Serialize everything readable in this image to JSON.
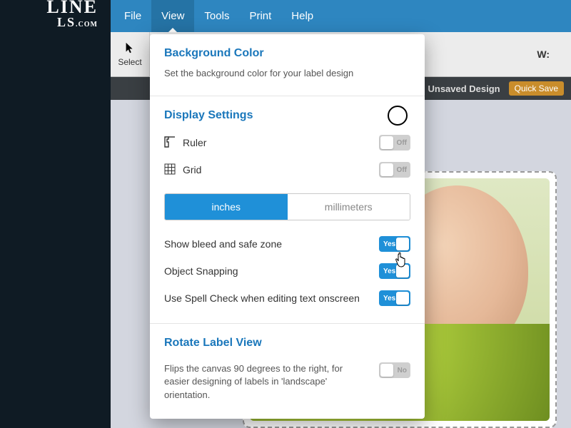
{
  "logo": {
    "line1": "LINE",
    "line2_main": "LS",
    "line2_suffix": ".COM"
  },
  "menu": {
    "items": [
      {
        "label": "File"
      },
      {
        "label": "View"
      },
      {
        "label": "Tools"
      },
      {
        "label": "Print"
      },
      {
        "label": "Help"
      }
    ],
    "active_index": 1
  },
  "toolbar": {
    "select_label": "Select",
    "w_label": "W:"
  },
  "status": {
    "unsaved_label": "Unsaved Design",
    "quick_save_label": "Quick Save"
  },
  "dropdown": {
    "bg": {
      "title": "Background Color",
      "desc": "Set the background color for your label design"
    },
    "display": {
      "title": "Display Settings",
      "ruler_label": "Ruler",
      "ruler_state": "Off",
      "grid_label": "Grid",
      "grid_state": "Off",
      "unit_inches": "inches",
      "unit_mm": "millimeters",
      "bleed_label": "Show bleed and safe zone",
      "bleed_state": "Yes",
      "snap_label": "Object Snapping",
      "snap_state": "Yes",
      "spell_label": "Use Spell Check when editing text onscreen",
      "spell_state": "Yes"
    },
    "rotate": {
      "title": "Rotate Label View",
      "desc": "Flips the canvas 90 degrees to the right, for easier designing of labels in 'landscape' orientation.",
      "state": "No"
    }
  }
}
